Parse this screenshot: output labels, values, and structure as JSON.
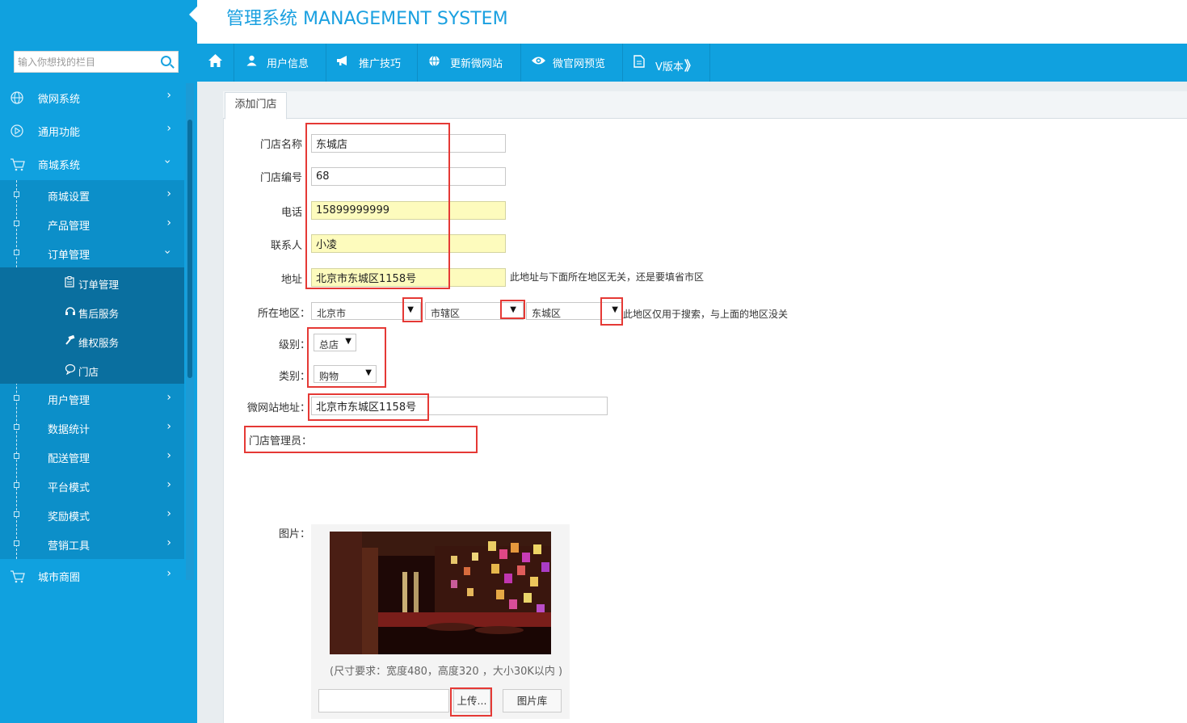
{
  "header": {
    "brand": "管理系统 MANAGEMENT SYSTEM"
  },
  "topnav": {
    "home_icon": "home-icon",
    "items": [
      {
        "label": "用户信息",
        "icon": "user-icon"
      },
      {
        "label": "推广技巧",
        "icon": "megaphone-icon"
      },
      {
        "label": "更新微网站",
        "icon": "globe-icon"
      },
      {
        "label": "微官网预览",
        "icon": "eye-icon"
      },
      {
        "label": "V版本",
        "icon": "document-icon",
        "suffix": "》"
      }
    ]
  },
  "sidebar": {
    "search_placeholder": "输入你想找的栏目",
    "top_items": [
      {
        "label": "微网系统",
        "icon": "globe-icon"
      },
      {
        "label": "通用功能",
        "icon": "play-circle-icon"
      },
      {
        "label": "商城系统",
        "icon": "cart-icon"
      }
    ],
    "sub_items": [
      {
        "label": "商城设置"
      },
      {
        "label": "产品管理"
      },
      {
        "label": "订单管理"
      },
      {
        "label": "用户管理"
      },
      {
        "label": "数据统计"
      },
      {
        "label": "配送管理"
      },
      {
        "label": "平台模式"
      },
      {
        "label": "奖励模式"
      },
      {
        "label": "营销工具"
      }
    ],
    "deep_items": [
      {
        "label": "订单管理",
        "icon": "clipboard-icon"
      },
      {
        "label": "售后服务",
        "icon": "headset-icon"
      },
      {
        "label": "维权服务",
        "icon": "hammer-icon"
      },
      {
        "label": "门店",
        "icon": "chat-icon"
      }
    ],
    "bottom_item": {
      "label": "城市商圈",
      "icon": "cart-icon"
    }
  },
  "tab": {
    "label": "添加门店"
  },
  "form": {
    "store_name_label": "门店名称",
    "store_name_value": "东城店",
    "store_no_label": "门店编号",
    "store_no_value": "68",
    "phone_label": "电话",
    "phone_value": "15899999999",
    "contact_label": "联系人",
    "contact_value": "小凌",
    "address_label": "地址",
    "address_value": "北京市东城区1158号",
    "address_hint": "此地址与下面所在地区无关，还是要填省市区",
    "region_label": "所在地区：",
    "province_value": "北京市",
    "city_value": "市辖区",
    "district_value": "东城区",
    "region_hint": "此地区仅用于搜索，与上面的地区没关",
    "level_label": "级别：",
    "level_value": "总店",
    "category_label": "类别：",
    "category_value": "购物",
    "site_address_label": "微网站地址：",
    "site_address_value": "北京市东城区1158号",
    "manager_label": "门店管理员：",
    "image_label": "图片：",
    "size_note": "(尺寸要求：宽度480，高度320 ，大小30K以内 )",
    "upload_button": "上传...",
    "gallery_button": "图片库"
  }
}
